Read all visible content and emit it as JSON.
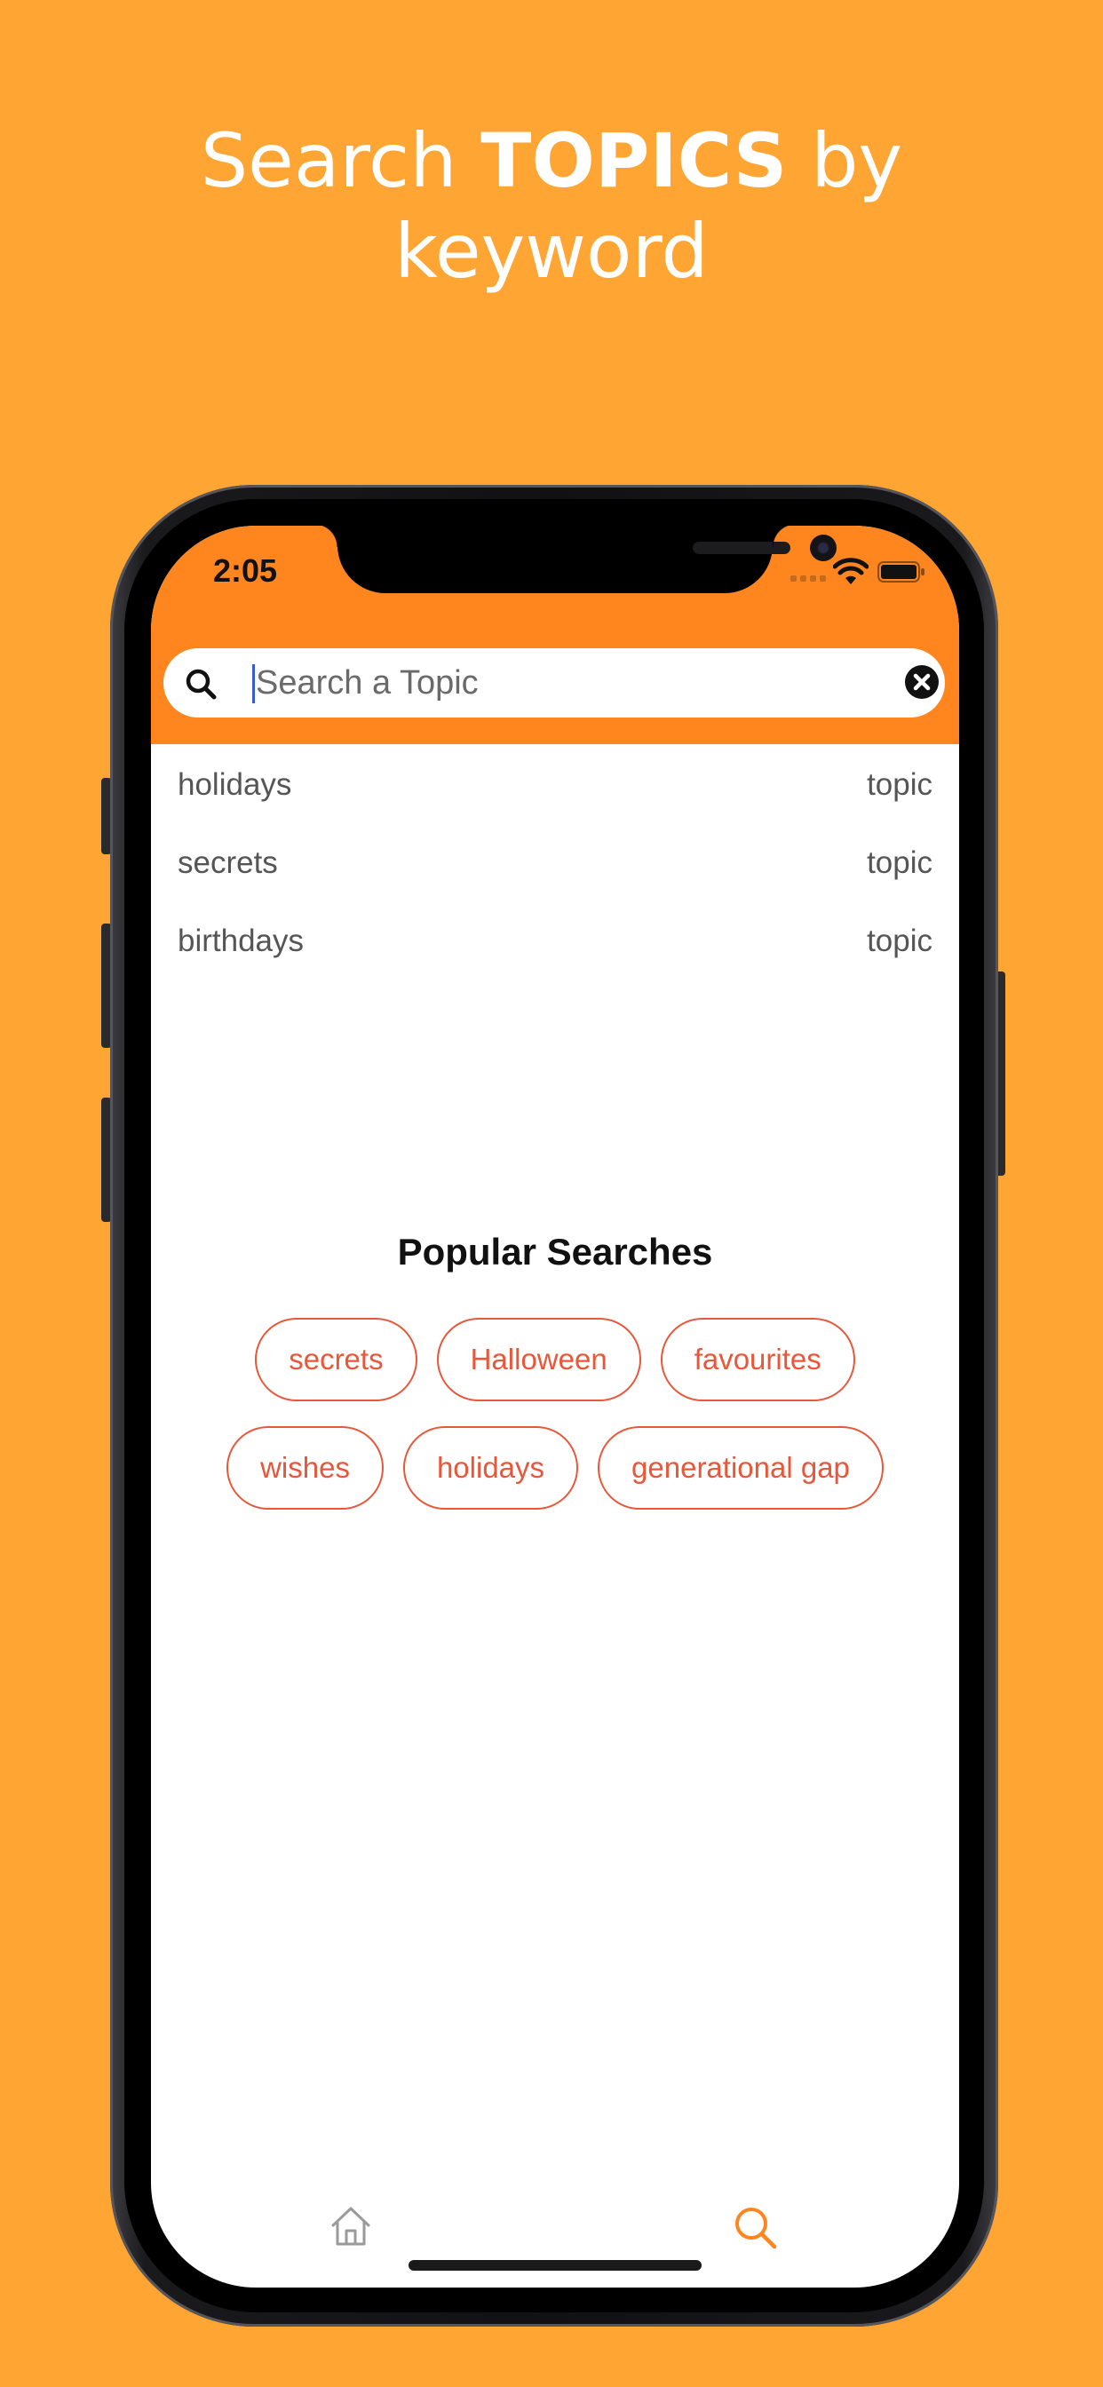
{
  "headline": {
    "prefix": "Search ",
    "bold": "TOPICS",
    "suffix": " by",
    "line2": "keyword"
  },
  "status_bar": {
    "time": "2:05"
  },
  "search": {
    "placeholder": "Search a Topic",
    "value": ""
  },
  "suggestions": [
    {
      "keyword": "holidays",
      "type": "topic"
    },
    {
      "keyword": "secrets",
      "type": "topic"
    },
    {
      "keyword": "birthdays",
      "type": "topic"
    }
  ],
  "popular": {
    "title": "Popular Searches",
    "row1": [
      "secrets",
      "Halloween",
      "favourites"
    ],
    "row2": [
      "wishes",
      "holidays",
      "generational gap"
    ]
  },
  "tabbar": {
    "items": [
      {
        "icon": "home-icon",
        "active": false
      },
      {
        "icon": "search-icon",
        "active": true
      }
    ]
  },
  "colors": {
    "background": "#FFA534",
    "header": "#FF861F",
    "chip_accent": "#E8573A",
    "tab_active": "#FF861F",
    "tab_inactive": "#9a9a9a"
  }
}
